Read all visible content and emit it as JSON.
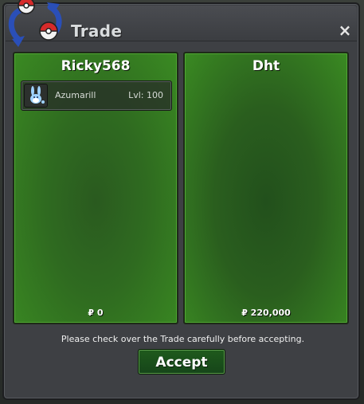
{
  "window": {
    "title": "Trade",
    "close_symbol": "×"
  },
  "players": [
    {
      "name": "Ricky568",
      "items": [
        {
          "name": "Azumarill",
          "level_text": "Lvl: 100",
          "icon": "azumarill-sprite-icon"
        }
      ],
      "money": "₽ 0"
    },
    {
      "name": "Dht",
      "items": [],
      "money": "₽ 220,000"
    }
  ],
  "notice": "Please check over the Trade carefully before accepting.",
  "accept_label": "Accept",
  "colors": {
    "panel_green": "#2f6b20",
    "window_bg": "#3e4044",
    "button_green": "#1f5a1c"
  }
}
